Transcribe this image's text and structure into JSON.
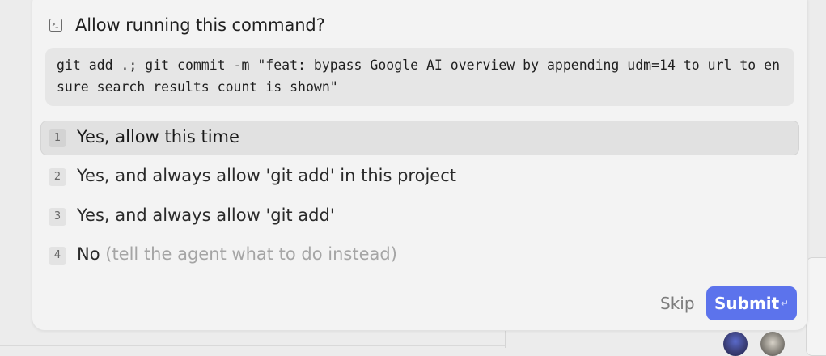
{
  "dialog": {
    "title": "Allow running this command?",
    "icon": "terminal-icon",
    "command": "git add .; git commit -m \"feat: bypass Google AI overview by appending udm=14 to url to en\nsure search results count is shown\"",
    "options": [
      {
        "number": "1",
        "label": "Yes, allow this time",
        "hint": "",
        "selected": true
      },
      {
        "number": "2",
        "label": "Yes, and always allow 'git add' in this project",
        "hint": ""
      },
      {
        "number": "3",
        "label": "Yes, and always allow 'git add'",
        "hint": ""
      },
      {
        "number": "4",
        "label": "No",
        "hint": "(tell the agent what to do instead)"
      }
    ],
    "skip_label": "Skip",
    "submit_label": "Submit",
    "submit_shortcut_icon": "enter-key-icon",
    "submit_shortcut_glyph": "↵"
  },
  "colors": {
    "accent": "#5c73ec",
    "dialog_bg": "#f3f3f3",
    "command_bg": "#e6e6e6",
    "selected_option_bg": "#e1e1e1",
    "hint_text": "#a5a5a5"
  }
}
